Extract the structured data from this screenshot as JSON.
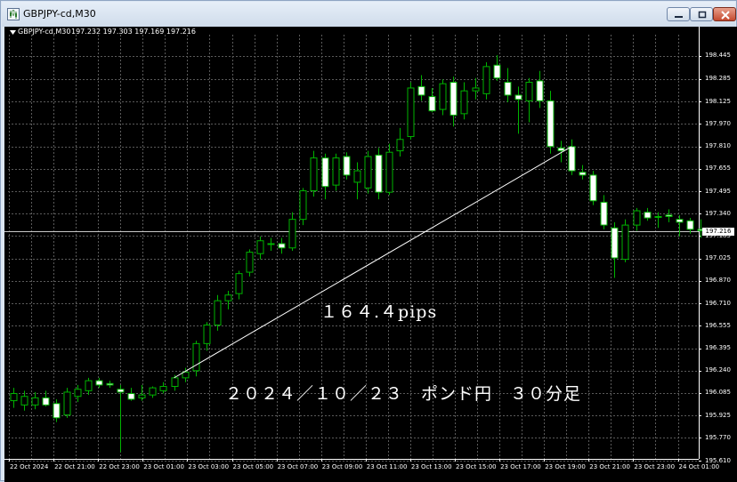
{
  "window": {
    "title": "GBPJPY-cd,M30"
  },
  "chart_header": {
    "symbol": "GBPJPY-cd,M30",
    "ohlc": "197.232 197.303 197.169 197.216"
  },
  "colors": {
    "background": "#000000",
    "grid": "#5a5a5a",
    "bull": "#00b400",
    "bear_fill": "#ffffff",
    "annotation": "#ffffff"
  },
  "annotations": {
    "pips": "１６４.４pips",
    "caption": "２０２４／１０／２３　ポンド円　３０分足"
  },
  "chart_data": {
    "type": "candlestick",
    "timeframe": "M30",
    "ylim": [
      195.61,
      198.5
    ],
    "price_axis_labels": [
      "198.445",
      "198.285",
      "198.125",
      "197.970",
      "197.810",
      "197.655",
      "197.495",
      "197.340",
      "197.185",
      "197.025",
      "196.870",
      "196.710",
      "196.555",
      "196.395",
      "196.240",
      "196.085",
      "195.925",
      "195.770",
      "195.610"
    ],
    "current_price": "197.216",
    "time_axis_labels": [
      "22 Oct 2024",
      "22 Oct 21:00",
      "22 Oct 23:00",
      "23 Oct 01:00",
      "23 Oct 03:00",
      "23 Oct 05:00",
      "23 Oct 07:00",
      "23 Oct 09:00",
      "23 Oct 11:00",
      "23 Oct 13:00",
      "23 Oct 15:00",
      "23 Oct 17:00",
      "23 Oct 19:00",
      "23 Oct 21:00",
      "23 Oct 23:00",
      "24 Oct 01:00"
    ],
    "candles": [
      {
        "o": 196.03,
        "h": 196.12,
        "l": 195.98,
        "c": 196.08
      },
      {
        "o": 196.0,
        "h": 196.1,
        "l": 195.96,
        "c": 196.06
      },
      {
        "o": 196.0,
        "h": 196.09,
        "l": 195.97,
        "c": 196.05
      },
      {
        "o": 196.05,
        "h": 196.1,
        "l": 195.99,
        "c": 196.0
      },
      {
        "o": 196.01,
        "h": 196.04,
        "l": 195.88,
        "c": 195.91
      },
      {
        "o": 195.93,
        "h": 196.12,
        "l": 195.91,
        "c": 196.09
      },
      {
        "o": 196.06,
        "h": 196.14,
        "l": 196.02,
        "c": 196.11
      },
      {
        "o": 196.1,
        "h": 196.19,
        "l": 196.07,
        "c": 196.17
      },
      {
        "o": 196.17,
        "h": 196.19,
        "l": 196.12,
        "c": 196.14
      },
      {
        "o": 196.15,
        "h": 196.17,
        "l": 196.12,
        "c": 196.14
      },
      {
        "o": 196.11,
        "h": 196.14,
        "l": 195.67,
        "c": 196.09
      },
      {
        "o": 196.08,
        "h": 196.12,
        "l": 196.03,
        "c": 196.04
      },
      {
        "o": 196.05,
        "h": 196.14,
        "l": 196.03,
        "c": 196.07
      },
      {
        "o": 196.07,
        "h": 196.13,
        "l": 196.05,
        "c": 196.12
      },
      {
        "o": 196.1,
        "h": 196.16,
        "l": 196.08,
        "c": 196.13
      },
      {
        "o": 196.13,
        "h": 196.21,
        "l": 196.1,
        "c": 196.19
      },
      {
        "o": 196.19,
        "h": 196.26,
        "l": 196.16,
        "c": 196.23
      },
      {
        "o": 196.24,
        "h": 196.45,
        "l": 196.2,
        "c": 196.43
      },
      {
        "o": 196.43,
        "h": 196.58,
        "l": 196.38,
        "c": 196.56
      },
      {
        "o": 196.56,
        "h": 196.77,
        "l": 196.52,
        "c": 196.73
      },
      {
        "o": 196.73,
        "h": 196.8,
        "l": 196.67,
        "c": 196.77
      },
      {
        "o": 196.78,
        "h": 196.94,
        "l": 196.74,
        "c": 196.92
      },
      {
        "o": 196.93,
        "h": 197.09,
        "l": 196.9,
        "c": 197.07
      },
      {
        "o": 197.06,
        "h": 197.18,
        "l": 197.02,
        "c": 197.15
      },
      {
        "o": 197.13,
        "h": 197.17,
        "l": 197.08,
        "c": 197.13
      },
      {
        "o": 197.13,
        "h": 197.17,
        "l": 197.06,
        "c": 197.1
      },
      {
        "o": 197.1,
        "h": 197.35,
        "l": 197.08,
        "c": 197.3
      },
      {
        "o": 197.3,
        "h": 197.52,
        "l": 197.26,
        "c": 197.5
      },
      {
        "o": 197.5,
        "h": 197.78,
        "l": 197.46,
        "c": 197.73
      },
      {
        "o": 197.73,
        "h": 197.76,
        "l": 197.44,
        "c": 197.53
      },
      {
        "o": 197.54,
        "h": 197.76,
        "l": 197.5,
        "c": 197.73
      },
      {
        "o": 197.74,
        "h": 197.77,
        "l": 197.58,
        "c": 197.61
      },
      {
        "o": 197.56,
        "h": 197.7,
        "l": 197.44,
        "c": 197.64
      },
      {
        "o": 197.52,
        "h": 197.78,
        "l": 197.48,
        "c": 197.74
      },
      {
        "o": 197.75,
        "h": 197.8,
        "l": 197.44,
        "c": 197.49
      },
      {
        "o": 197.49,
        "h": 197.83,
        "l": 197.47,
        "c": 197.77
      },
      {
        "o": 197.78,
        "h": 197.94,
        "l": 197.74,
        "c": 197.86
      },
      {
        "o": 197.88,
        "h": 198.26,
        "l": 197.86,
        "c": 198.22
      },
      {
        "o": 198.23,
        "h": 198.31,
        "l": 198.13,
        "c": 198.17
      },
      {
        "o": 198.16,
        "h": 198.22,
        "l": 198.05,
        "c": 198.06
      },
      {
        "o": 198.07,
        "h": 198.28,
        "l": 198.03,
        "c": 198.25
      },
      {
        "o": 198.26,
        "h": 198.3,
        "l": 197.95,
        "c": 198.03
      },
      {
        "o": 198.04,
        "h": 198.26,
        "l": 198.0,
        "c": 198.2
      },
      {
        "o": 198.2,
        "h": 198.29,
        "l": 198.14,
        "c": 198.22
      },
      {
        "o": 198.18,
        "h": 198.4,
        "l": 198.14,
        "c": 198.37
      },
      {
        "o": 198.38,
        "h": 198.45,
        "l": 198.27,
        "c": 198.29
      },
      {
        "o": 198.26,
        "h": 198.36,
        "l": 198.12,
        "c": 198.17
      },
      {
        "o": 198.17,
        "h": 198.23,
        "l": 197.9,
        "c": 198.14
      },
      {
        "o": 198.13,
        "h": 198.29,
        "l": 197.98,
        "c": 198.26
      },
      {
        "o": 198.27,
        "h": 198.34,
        "l": 198.08,
        "c": 198.13
      },
      {
        "o": 198.13,
        "h": 198.2,
        "l": 197.76,
        "c": 197.81
      },
      {
        "o": 197.8,
        "h": 197.85,
        "l": 197.7,
        "c": 197.78
      },
      {
        "o": 197.81,
        "h": 197.86,
        "l": 197.61,
        "c": 197.64
      },
      {
        "o": 197.63,
        "h": 197.68,
        "l": 197.58,
        "c": 197.61
      },
      {
        "o": 197.61,
        "h": 197.64,
        "l": 197.4,
        "c": 197.43
      },
      {
        "o": 197.42,
        "h": 197.47,
        "l": 197.23,
        "c": 197.26
      },
      {
        "o": 197.24,
        "h": 197.28,
        "l": 196.89,
        "c": 197.03
      },
      {
        "o": 197.02,
        "h": 197.3,
        "l": 197.0,
        "c": 197.26
      },
      {
        "o": 197.26,
        "h": 197.38,
        "l": 197.22,
        "c": 197.36
      },
      {
        "o": 197.35,
        "h": 197.38,
        "l": 197.29,
        "c": 197.31
      },
      {
        "o": 197.32,
        "h": 197.35,
        "l": 197.24,
        "c": 197.32
      },
      {
        "o": 197.33,
        "h": 197.37,
        "l": 197.28,
        "c": 197.32
      },
      {
        "o": 197.3,
        "h": 197.33,
        "l": 197.18,
        "c": 197.28
      },
      {
        "o": 197.29,
        "h": 197.31,
        "l": 197.2,
        "c": 197.23
      },
      {
        "o": 197.23,
        "h": 197.3,
        "l": 197.17,
        "c": 197.22
      }
    ],
    "trendline": {
      "from_candle": 15,
      "from_price": 196.19,
      "to_candle": 52,
      "to_price": 197.81
    }
  }
}
